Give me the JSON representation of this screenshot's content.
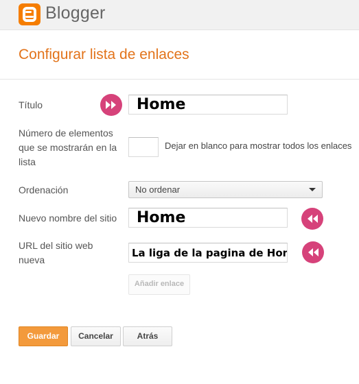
{
  "app": {
    "name": "Blogger",
    "logo_icon": "blogger-logo-icon"
  },
  "page": {
    "title": "Configurar lista de enlaces"
  },
  "form": {
    "titulo": {
      "label": "Título",
      "value": "Home"
    },
    "count": {
      "label_line1": "Número de elementos",
      "label_line2": "que se mostrarán en la",
      "label_line3": "lista",
      "value": "",
      "hint": "Dejar en blanco para mostrar todos los enlaces"
    },
    "order": {
      "label": "Ordenación",
      "selected": "No ordenar"
    },
    "site_name": {
      "label": "Nuevo nombre del sitio",
      "value": "Home"
    },
    "site_url": {
      "label_line1": "URL del sitio web",
      "label_line2": "nueva",
      "value": "La liga de la pagina de Home"
    },
    "add_link_label": "Añadir enlace"
  },
  "actions": {
    "save": "Guardar",
    "cancel": "Cancelar",
    "back": "Atrás"
  },
  "annotations": {
    "color": "#d6427a",
    "icons": [
      "double-arrow-right-icon",
      "double-arrow-left-icon",
      "double-arrow-left-icon"
    ]
  },
  "colors": {
    "accent": "#e2731a",
    "primary_button": "#f39a3c",
    "logo": "#f57d00"
  }
}
